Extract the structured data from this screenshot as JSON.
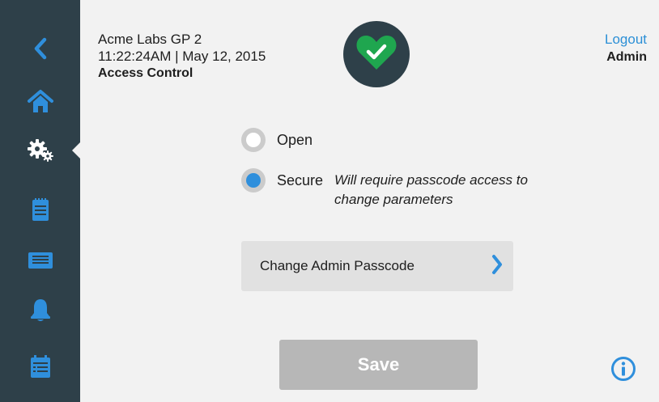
{
  "header": {
    "device_name": "Acme Labs GP 2",
    "datetime": "11:22:24AM | May 12, 2015",
    "section_title": "Access Control",
    "status_icon": "heart-check-icon",
    "logout_label": "Logout",
    "user_role": "Admin"
  },
  "sidebar": {
    "items": [
      {
        "name": "back",
        "icon": "chevron-left-icon"
      },
      {
        "name": "home",
        "icon": "home-icon"
      },
      {
        "name": "settings",
        "icon": "gears-icon",
        "active": true
      },
      {
        "name": "notes",
        "icon": "notepad-icon"
      },
      {
        "name": "display",
        "icon": "monitor-icon"
      },
      {
        "name": "alerts",
        "icon": "bell-icon"
      },
      {
        "name": "log",
        "icon": "calendar-list-icon"
      }
    ]
  },
  "access": {
    "options": [
      {
        "label": "Open",
        "selected": false
      },
      {
        "label": "Secure",
        "selected": true,
        "note": "Will require passcode access to change parameters"
      }
    ],
    "change_passcode_label": "Change Admin Passcode"
  },
  "footer": {
    "save_label": "Save"
  },
  "colors": {
    "sidebar_bg": "#2e4049",
    "accent_blue": "#2f8fdc",
    "status_green": "#1fa64f",
    "save_disabled": "#b7b7b7"
  }
}
